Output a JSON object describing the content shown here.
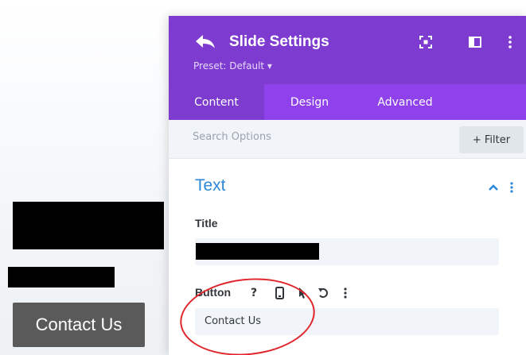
{
  "page": {
    "contact_button": "Contact Us"
  },
  "panel": {
    "title": "Slide Settings",
    "preset": "Preset: Default ▾",
    "tabs": [
      {
        "label": "Content",
        "active": true
      },
      {
        "label": "Design",
        "active": false
      },
      {
        "label": "Advanced",
        "active": false
      }
    ],
    "search": {
      "placeholder": "Search Options",
      "filter_label": "+ Filter"
    },
    "section": {
      "title": "Text"
    },
    "fields": {
      "title_label": "Title",
      "button_label": "Button",
      "button_value": "Contact Us"
    }
  },
  "colors": {
    "header": "#7d3bcf",
    "tabs": "#8f42ec",
    "section_title": "#2b87da",
    "annotation": "#e0262d"
  }
}
